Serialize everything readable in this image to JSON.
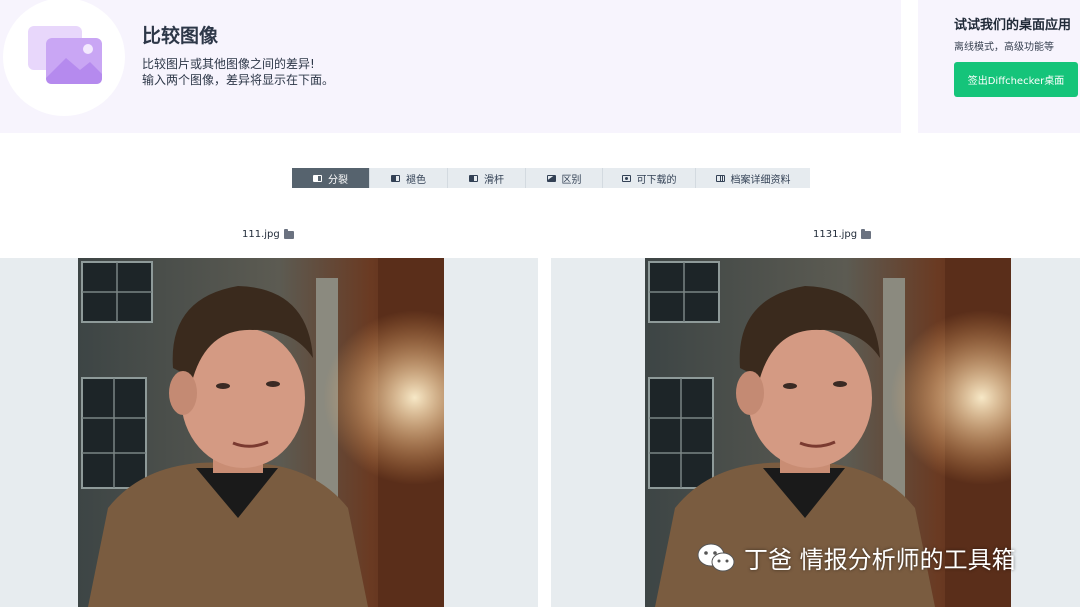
{
  "header": {
    "title": "比较图像",
    "description_line1": "比较图片或其他图像之间的差异!",
    "description_line2": "输入两个图像，差异将显示在下面。"
  },
  "promo": {
    "title": "试试我们的桌面应用",
    "subtitle": "离线模式，高级功能等",
    "button_label": "签出Diffchecker桌面"
  },
  "tabs": [
    {
      "label": "分裂",
      "icon": "split-icon",
      "active": true
    },
    {
      "label": "褪色",
      "icon": "fade-icon",
      "active": false
    },
    {
      "label": "滑杆",
      "icon": "slider-icon",
      "active": false
    },
    {
      "label": "区别",
      "icon": "difference-icon",
      "active": false
    },
    {
      "label": "可下载的",
      "icon": "download-icon",
      "active": false
    },
    {
      "label": "档案详细资料",
      "icon": "details-icon",
      "active": false
    }
  ],
  "files": {
    "left": {
      "name": "111.jpg",
      "icon": "folder-icon"
    },
    "right": {
      "name": "1131.jpg",
      "icon": "folder-icon"
    }
  },
  "watermark": {
    "icon": "wechat-icon",
    "text": "丁爸 情报分析师的工具箱"
  },
  "colors": {
    "header_bg": "#f7f4fd",
    "accent_green": "#15c47a",
    "active_tab": "#56636e",
    "tab_bg": "#e6ebef",
    "panel_bg": "#e7ecef"
  }
}
